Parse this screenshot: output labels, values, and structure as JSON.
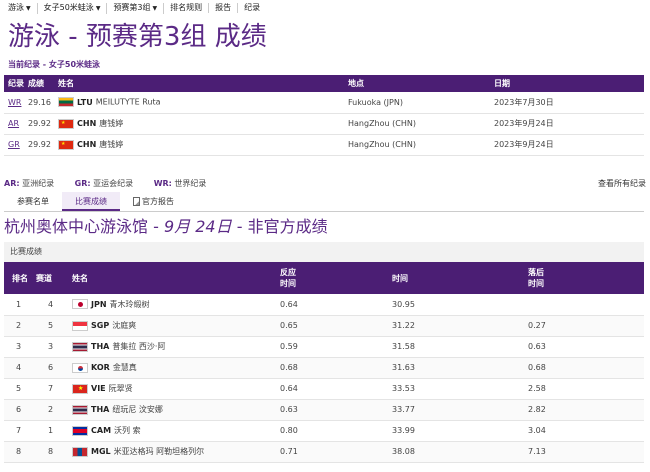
{
  "nav": [
    {
      "label": "游泳",
      "caret": true
    },
    {
      "label": "女子50米蛙泳",
      "caret": true
    },
    {
      "label": "预赛第3组",
      "caret": true
    },
    {
      "label": "排名规则",
      "caret": false
    },
    {
      "label": "报告",
      "caret": false
    },
    {
      "label": "纪录",
      "caret": false
    }
  ],
  "page_title": "游泳 - 预赛第3组 成绩",
  "record_heading": "当前纪录 - 女子50米蛙泳",
  "records": {
    "headers": [
      "纪录",
      "成绩",
      "姓名",
      "地点",
      "日期"
    ],
    "rows": [
      {
        "code": "WR",
        "time": "29.16",
        "noc": "LTU",
        "flag": "ltu",
        "name": "MEILUTYTE Ruta",
        "place": "Fukuoka (JPN)",
        "date": "2023年7月30日"
      },
      {
        "code": "AR",
        "time": "29.92",
        "noc": "CHN",
        "flag": "chn",
        "name": "唐钱婷",
        "place": "HangZhou (CHN)",
        "date": "2023年9月24日"
      },
      {
        "code": "GR",
        "time": "29.92",
        "noc": "CHN",
        "flag": "chn",
        "name": "唐钱婷",
        "place": "HangZhou (CHN)",
        "date": "2023年9月24日"
      }
    ]
  },
  "legend": [
    {
      "code": "AR:",
      "text": "亚洲纪录"
    },
    {
      "code": "GR:",
      "text": "亚运会纪录"
    },
    {
      "code": "WR:",
      "text": "世界纪录"
    }
  ],
  "view_all": "查看所有纪录",
  "tabs": [
    {
      "label": "参赛名单",
      "active": false
    },
    {
      "label": "比赛成绩",
      "active": true
    },
    {
      "label": "官方报告",
      "active": false,
      "icon": "pdf-icon"
    }
  ],
  "venue": {
    "place": "杭州奥体中心游泳馆",
    "sep1": " - ",
    "date": "9月 24日",
    "sep2": " - ",
    "status": "非官方成绩"
  },
  "results_header": "比赛成绩",
  "results": {
    "headers": {
      "rank": "排名",
      "lane": "赛道",
      "name": "姓名",
      "reaction": "反应\n时间",
      "time": "时间",
      "behind": "落后\n时间"
    },
    "rows": [
      {
        "rank": "1",
        "lane": "4",
        "flag": "jpn",
        "noc": "JPN",
        "name": "青木玲缎树",
        "reaction": "0.64",
        "time": "30.95",
        "behind": ""
      },
      {
        "rank": "2",
        "lane": "5",
        "flag": "sgp",
        "noc": "SGP",
        "name": "沈庭爽",
        "reaction": "0.65",
        "time": "31.22",
        "behind": "0.27"
      },
      {
        "rank": "3",
        "lane": "3",
        "flag": "tha",
        "noc": "THA",
        "name": "普集拉 西沙·阿",
        "reaction": "0.59",
        "time": "31.58",
        "behind": "0.63"
      },
      {
        "rank": "4",
        "lane": "6",
        "flag": "kor",
        "noc": "KOR",
        "name": "金慧真",
        "reaction": "0.68",
        "time": "31.63",
        "behind": "0.68"
      },
      {
        "rank": "5",
        "lane": "7",
        "flag": "vie",
        "noc": "VIE",
        "name": "阮翠贤",
        "reaction": "0.64",
        "time": "33.53",
        "behind": "2.58"
      },
      {
        "rank": "6",
        "lane": "2",
        "flag": "tha",
        "noc": "THA",
        "name": "纽玩尼 汶安娜",
        "reaction": "0.63",
        "time": "33.77",
        "behind": "2.82"
      },
      {
        "rank": "7",
        "lane": "1",
        "flag": "cam",
        "noc": "CAM",
        "name": "沃列 索",
        "reaction": "0.80",
        "time": "33.99",
        "behind": "3.04"
      },
      {
        "rank": "8",
        "lane": "8",
        "flag": "mgl",
        "noc": "MGL",
        "name": "米亚达格玛 阿勒坦格列尔",
        "reaction": "0.71",
        "time": "38.08",
        "behind": "7.13"
      }
    ]
  }
}
